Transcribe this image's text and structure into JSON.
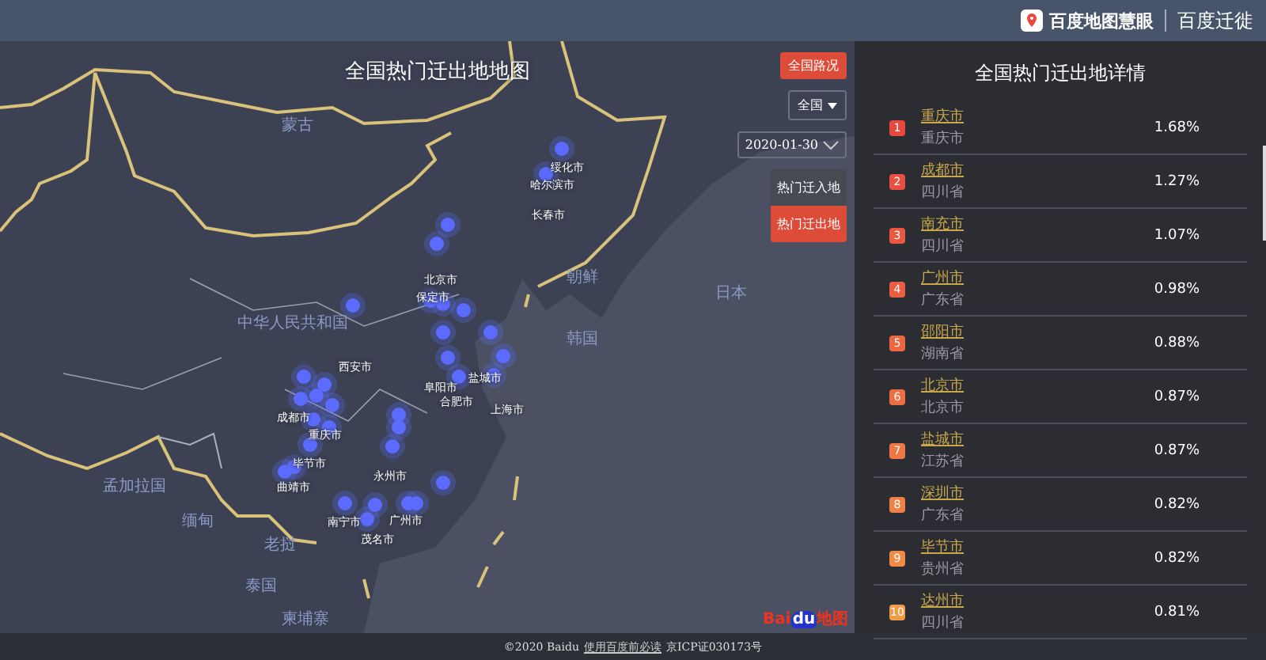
{
  "header": {
    "brand": "百度地图慧眼",
    "product": "百度迁徙"
  },
  "map": {
    "title": "全国热门迁出地地图",
    "countries": [
      "蒙古",
      "中华人民共和国",
      "朝鲜",
      "日本",
      "韩国",
      "孟加拉国",
      "缅甸",
      "老挝",
      "泰国",
      "柬埔寨"
    ],
    "cities": [
      "绥化市",
      "哈尔滨市",
      "长春市",
      "北京市",
      "保定市",
      "西安市",
      "盐城市",
      "阜阳市",
      "合肥市",
      "上海市",
      "成都市",
      "重庆市",
      "毕节市",
      "永州市",
      "曲靖市",
      "南宁市",
      "广州市",
      "茂名市"
    ],
    "logo": {
      "part_1": "Bai",
      "part_2": "du",
      "part_3": "地图"
    }
  },
  "controls": {
    "traffic_button": "全国路况",
    "region_select": "全国",
    "date_picker": "2020-01-30",
    "tabs": [
      {
        "label": "热门迁入地",
        "selected": false
      },
      {
        "label": "热门迁出地",
        "selected": true
      }
    ]
  },
  "panel": {
    "title": "全国热门迁出地详情",
    "rows": [
      {
        "rank": "1",
        "city": "重庆市",
        "province": "重庆市",
        "share": "1.68%",
        "color": "#e8493e"
      },
      {
        "rank": "2",
        "city": "成都市",
        "province": "四川省",
        "share": "1.27%",
        "color": "#e9503f"
      },
      {
        "rank": "3",
        "city": "南充市",
        "province": "四川省",
        "share": "1.07%",
        "color": "#ea5740"
      },
      {
        "rank": "4",
        "city": "广州市",
        "province": "广东省",
        "share": "0.98%",
        "color": "#eb5e41"
      },
      {
        "rank": "5",
        "city": "邵阳市",
        "province": "湖南省",
        "share": "0.88%",
        "color": "#ec6642"
      },
      {
        "rank": "6",
        "city": "北京市",
        "province": "北京市",
        "share": "0.87%",
        "color": "#ed6e43"
      },
      {
        "rank": "7",
        "city": "盐城市",
        "province": "江苏省",
        "share": "0.87%",
        "color": "#ee7745"
      },
      {
        "rank": "8",
        "city": "深圳市",
        "province": "广东省",
        "share": "0.82%",
        "color": "#ef8046"
      },
      {
        "rank": "9",
        "city": "毕节市",
        "province": "贵州省",
        "share": "0.82%",
        "color": "#f08a47"
      },
      {
        "rank": "10",
        "city": "达州市",
        "province": "四川省",
        "share": "0.81%",
        "color": "#f19a48"
      }
    ]
  },
  "footer": {
    "copyright": "©2020 Baidu",
    "link": "使用百度前必读",
    "license": "京ICP证030173号"
  }
}
